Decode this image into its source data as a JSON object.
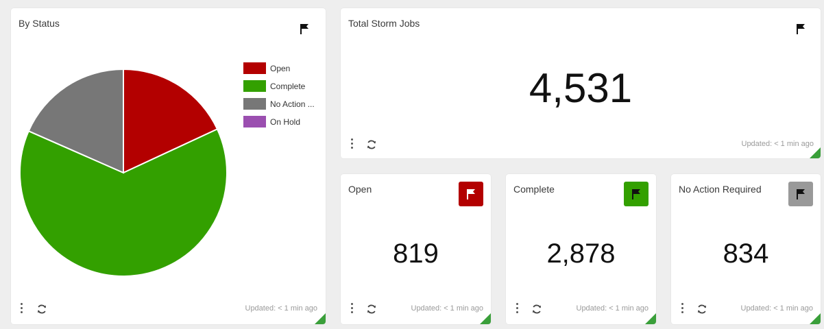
{
  "by_status": {
    "title": "By Status",
    "updated": "Updated: < 1 min ago",
    "flag_color": "#111111"
  },
  "chart_data": {
    "type": "pie",
    "title": "",
    "slices": [
      {
        "label": "Open",
        "value": 819,
        "color": "#b30000"
      },
      {
        "label": "Complete",
        "value": 2878,
        "color": "#33a000"
      },
      {
        "label": "No Action ...",
        "value": 834,
        "color": "#777777"
      },
      {
        "label": "On Hold",
        "value": 0,
        "color": "#9b4fb0"
      }
    ],
    "legend_position": "right",
    "start_angle": "top",
    "direction": "clockwise"
  },
  "total": {
    "title": "Total Storm Jobs",
    "value": "4,531",
    "updated": "Updated: < 1 min ago"
  },
  "tiles": [
    {
      "title": "Open",
      "value": "819",
      "updated": "Updated: < 1 min ago",
      "flag_bg": "#b30000",
      "flag_fg": "#ffffff"
    },
    {
      "title": "Complete",
      "value": "2,878",
      "updated": "Updated: < 1 min ago",
      "flag_bg": "#33a000",
      "flag_fg": "#111111"
    },
    {
      "title": "No Action Required",
      "value": "834",
      "updated": "Updated: < 1 min ago",
      "flag_bg": "#999999",
      "flag_fg": "#111111"
    }
  ],
  "icons": {
    "flag": "flag-icon",
    "menu": "kebab-menu-icon",
    "refresh": "refresh-icon"
  },
  "accent_corner": "#3a9f3a"
}
